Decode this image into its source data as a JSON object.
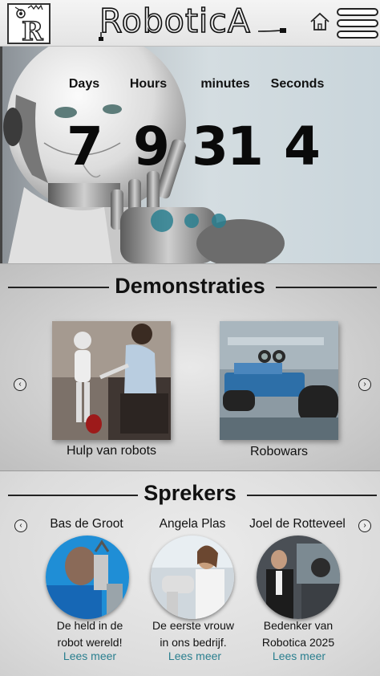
{
  "header": {
    "brand": "RoboticA",
    "logo_letter": "R",
    "home_icon": "home-icon",
    "menu_icon": "hamburger-menu-icon"
  },
  "countdown": {
    "labels": [
      "Days",
      "Hours",
      "minutes",
      "Seconds"
    ],
    "values": [
      "7",
      "9",
      "31",
      "4"
    ]
  },
  "hero_carousel": {
    "slides": 3,
    "active_index": 0,
    "color": "#2a7f8f"
  },
  "demonstrations": {
    "title": "Demonstraties",
    "items": [
      {
        "caption": "Hulp van robots",
        "image": "robot-helping-man-image"
      },
      {
        "caption": "Robowars",
        "image": "robot-toy-car-image"
      }
    ],
    "prev_icon": "chevron-left-icon",
    "next_icon": "chevron-right-icon"
  },
  "speakers": {
    "title": "Sprekers",
    "items": [
      {
        "name": "Bas de Groot",
        "desc_line1": "De held in de",
        "desc_line2": "robot wereld!",
        "link": "Lees meer"
      },
      {
        "name": "Angela Plas",
        "desc_line1": "De eerste vrouw",
        "desc_line2": "in ons bedrijf.",
        "link": "Lees meer"
      },
      {
        "name": "Joel de Rotteveel",
        "desc_line1": "Bedenker van",
        "desc_line2": "Robotica 2025",
        "link": "Lees meer"
      }
    ]
  },
  "colors": {
    "accent": "#2a7f8f",
    "text": "#111111"
  }
}
